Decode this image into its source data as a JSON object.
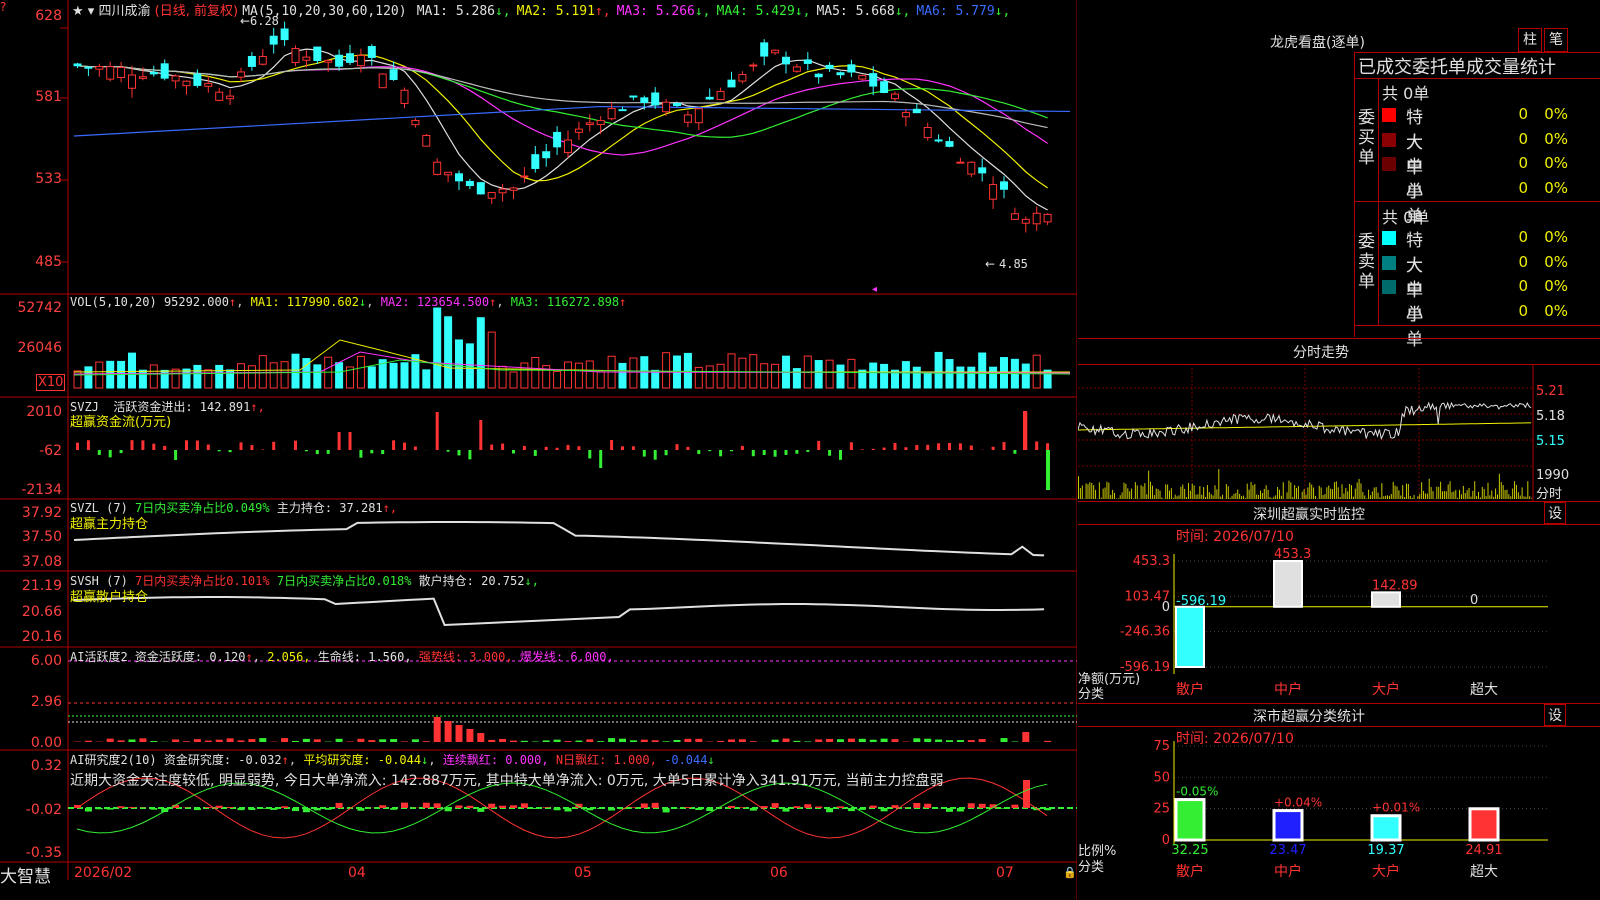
{
  "stock": {
    "name": "四川成渝",
    "mode": "(日线, 前复权)",
    "ma_header": "MA(5,10,20,30,60,120)",
    "ma_values": [
      {
        "label": "MA1:",
        "value": "5.286",
        "arrow": "↓",
        "color": "#e0e0e0"
      },
      {
        "label": "MA2:",
        "value": "5.191",
        "arrow": "↑",
        "color": "#f0f000"
      },
      {
        "label": "MA3:",
        "value": "5.266",
        "arrow": "↓",
        "color": "#ff33ff"
      },
      {
        "label": "MA4:",
        "value": "5.429",
        "arrow": "↓",
        "color": "#33ee33"
      },
      {
        "label": "MA5:",
        "value": "5.668",
        "arrow": "↓",
        "color": "#e0e0e0"
      },
      {
        "label": "MA6:",
        "value": "5.779",
        "arrow": "↓",
        "color": "#3a6bff"
      }
    ],
    "high_marker": "6.28",
    "low_marker": "4.85",
    "price_axis": [
      "628",
      "581",
      "533",
      "485"
    ]
  },
  "vol": {
    "header": "VOL(5,10,20)",
    "value": "95292.000",
    "ma1": "MA1: 117990.602",
    "ma1_arrow": "↓",
    "ma2": "MA2: 123654.500",
    "ma2_arrow": "↑",
    "ma3": "MA3: 116272.898",
    "ma3_arrow": "↑",
    "axis": [
      "52742",
      "26046"
    ],
    "unit": "X10"
  },
  "svzj": {
    "header": "SVZJ",
    "label": "活跃资金进出: 142.891",
    "arrow": "↑,",
    "sub": "超赢资金流(万元)",
    "axis": [
      "2010",
      "-62",
      "-2134"
    ]
  },
  "svzl": {
    "header": "SVZL (7)",
    "t1": "7日内买卖净占比0.049%",
    "t2": "主力持仓: 37.281",
    "arrow": "↑,",
    "sub": "超赢主力持仓",
    "axis": [
      "37.92",
      "37.50",
      "37.08"
    ]
  },
  "svsh": {
    "header": "SVSH (7)",
    "t1": "7日内买卖净占比0.101%",
    "t2": "7日内买卖净占比0.018%",
    "t3": "散户持仓: 20.752",
    "arrow": "↓,",
    "sub": "超赢散户持仓",
    "axis": [
      "21.19",
      "20.66",
      "20.16"
    ]
  },
  "ai_huoyue": {
    "header": "AI活跃度2",
    "t1": "资金活跃度: 0.120",
    "t2": "2.056,",
    "t3": "生命线: 1.560,",
    "t4": "强势线: 3.000,",
    "t5": "爆发线: 6.000,",
    "axis": [
      "6.00",
      "2.96",
      "0.00"
    ]
  },
  "ai_yanjiu": {
    "header": "AI研究度2(10)",
    "t1": "资金研究度: -0.032",
    "t2": "平均研究度: -0.044",
    "t3": "连续飘红: 0.000,",
    "t4": "N日飘红: 1.000,",
    "t5": "-0.044",
    "comment": "近期大资金关注度较低, 明显弱势, 今日大单净流入: 142.887万元, 其中特大单净流入: 0万元, 大单5日累计净入341.91万元, 当前主力控盘弱",
    "axis": [
      "0.32",
      "-0.02",
      "-0.35"
    ]
  },
  "xaxis": [
    "2026/02",
    "04",
    "05",
    "06",
    "07"
  ],
  "brand": "大智慧",
  "longhu": {
    "title": "龙虎看盘(逐单)",
    "btn_zhu": "柱",
    "btn_bi": "笔",
    "tabs": "已成交委托单成交量统计",
    "buy_label": "委买单",
    "sell_label": "委卖单",
    "buy_total": "共 0单",
    "sell_total": "共 0单",
    "buy_rows": [
      {
        "name": "特大",
        "v": "0",
        "p": "0%",
        "color": "#ff0000"
      },
      {
        "name": "大单",
        "v": "0",
        "p": "0%",
        "color": "#8b0000"
      },
      {
        "name": "中单",
        "v": "0",
        "p": "0%",
        "color": "#6b0000"
      },
      {
        "name": "小单",
        "v": "0",
        "p": "0%",
        "color": ""
      }
    ],
    "sell_rows": [
      {
        "name": "特大",
        "v": "0",
        "p": "0%",
        "color": "#00ffff"
      },
      {
        "name": "大单",
        "v": "0",
        "p": "0%",
        "color": "#008080"
      },
      {
        "name": "中单",
        "v": "0",
        "p": "0%",
        "color": "#006b6b"
      },
      {
        "name": "小单",
        "v": "0",
        "p": "0%",
        "color": ""
      }
    ]
  },
  "fenshi": {
    "title": "分时走势",
    "axis": [
      "5.21",
      "5.18",
      "5.15"
    ],
    "vol_top": "1990",
    "vol_label": "分时"
  },
  "monitor": {
    "title": "深圳超赢实时监控",
    "set": "设",
    "time": "时间: 2026/07/10",
    "axis": [
      "453.3",
      "103.47",
      "0",
      "-246.36",
      "-596.19"
    ],
    "y_label": "净额(万元)",
    "x_label": "分类",
    "cats": [
      "散户",
      "中户",
      "大户",
      "超大"
    ],
    "values": [
      "-596.19",
      "453.3",
      "142.89",
      "0"
    ]
  },
  "fenlei": {
    "title": "深市超赢分类统计",
    "set": "设",
    "time": "时间: 2026/07/10",
    "axis": [
      "75",
      "50",
      "25",
      "0"
    ],
    "y_label": "比例%",
    "x_label": "分类",
    "cats": [
      "散户",
      "中户",
      "大户",
      "超大"
    ],
    "values": [
      "32.25",
      "23.47",
      "19.37",
      "24.91"
    ],
    "deltas": [
      "-0.05%",
      "+0.04%",
      "+0.01%",
      ""
    ]
  },
  "chart_data": {
    "type": "bar",
    "title": "深圳超赢实时监控",
    "ylabel": "净额(万元)",
    "categories": [
      "散户",
      "中户",
      "大户",
      "超大"
    ],
    "values": [
      -596.19,
      453.3,
      142.89,
      0
    ],
    "ylim": [
      -596.19,
      453.3
    ]
  }
}
